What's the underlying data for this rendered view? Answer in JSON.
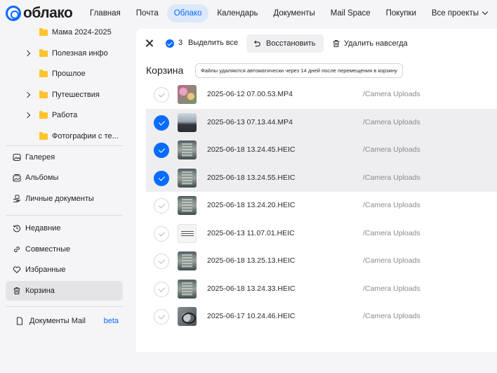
{
  "app": {
    "logo_text": "облако"
  },
  "nav": [
    {
      "label": "Главная",
      "active": false
    },
    {
      "label": "Почта",
      "active": false
    },
    {
      "label": "Облако",
      "active": true
    },
    {
      "label": "Календарь",
      "active": false
    },
    {
      "label": "Документы",
      "active": false
    },
    {
      "label": "Mail Space",
      "active": false
    },
    {
      "label": "Покупки",
      "active": false
    },
    {
      "label": "Все проекты",
      "active": false
    }
  ],
  "sidebar": {
    "folders": [
      {
        "label": "Мама 2024-2025",
        "has_chevron": false
      },
      {
        "label": "Полезная инфо",
        "has_chevron": true
      },
      {
        "label": "Прошлое",
        "has_chevron": false
      },
      {
        "label": "Путешествия",
        "has_chevron": true
      },
      {
        "label": "Работа",
        "has_chevron": true
      },
      {
        "label": "Фотографии с те...",
        "has_chevron": false
      }
    ],
    "items": [
      {
        "label": "Галерея",
        "icon": "gallery-icon"
      },
      {
        "label": "Альбомы",
        "icon": "albums-icon"
      },
      {
        "label": "Личные документы",
        "icon": "documents-hand-icon"
      },
      {
        "label": "Недавние",
        "icon": "history-icon"
      },
      {
        "label": "Совместные",
        "icon": "link-icon"
      },
      {
        "label": "Избранные",
        "icon": "heart-icon"
      },
      {
        "label": "Корзина",
        "icon": "trash-icon"
      }
    ],
    "docs_mail": {
      "label": "Документы Mail",
      "badge": "beta",
      "icon": "document-icon"
    }
  },
  "toolbar": {
    "selected_count": "3",
    "select_all_label": "Выделить все",
    "restore_label": "Восстановить",
    "delete_label": "Удалить навсегда"
  },
  "trash": {
    "title": "Корзина",
    "notice": "Файлы удаляются автоматически через 14 дней после перемещения в корзину"
  },
  "files": [
    {
      "name": "2025-06-12 07.00.53.MP4",
      "path": "/Camera Uploads",
      "selected": false,
      "thumb": "flowers"
    },
    {
      "name": "2025-06-13 07.13.44.MP4",
      "path": "/Camera Uploads",
      "selected": true,
      "thumb": "street"
    },
    {
      "name": "2025-06-18 13.24.45.HEIC",
      "path": "/Camera Uploads",
      "selected": true,
      "thumb": "phone"
    },
    {
      "name": "2025-06-18 13.24.55.HEIC",
      "path": "/Camera Uploads",
      "selected": true,
      "thumb": "phone"
    },
    {
      "name": "2025-06-18 13.24.20.HEIC",
      "path": "/Camera Uploads",
      "selected": false,
      "thumb": "phone"
    },
    {
      "name": "2025-06-13 11.07.01.HEIC",
      "path": "/Camera Uploads",
      "selected": false,
      "thumb": "doc"
    },
    {
      "name": "2025-06-18 13.25.13.HEIC",
      "path": "/Camera Uploads",
      "selected": false,
      "thumb": "phone"
    },
    {
      "name": "2025-06-18 13.24.33.HEIC",
      "path": "/Camera Uploads",
      "selected": false,
      "thumb": "phone"
    },
    {
      "name": "2025-06-17 10.24.46.HEIC",
      "path": "/Camera Uploads",
      "selected": false,
      "thumb": "cable"
    }
  ],
  "colors": {
    "accent": "#0a6cff",
    "folder": "#ffc32b",
    "selected_row": "#eeeef0"
  }
}
